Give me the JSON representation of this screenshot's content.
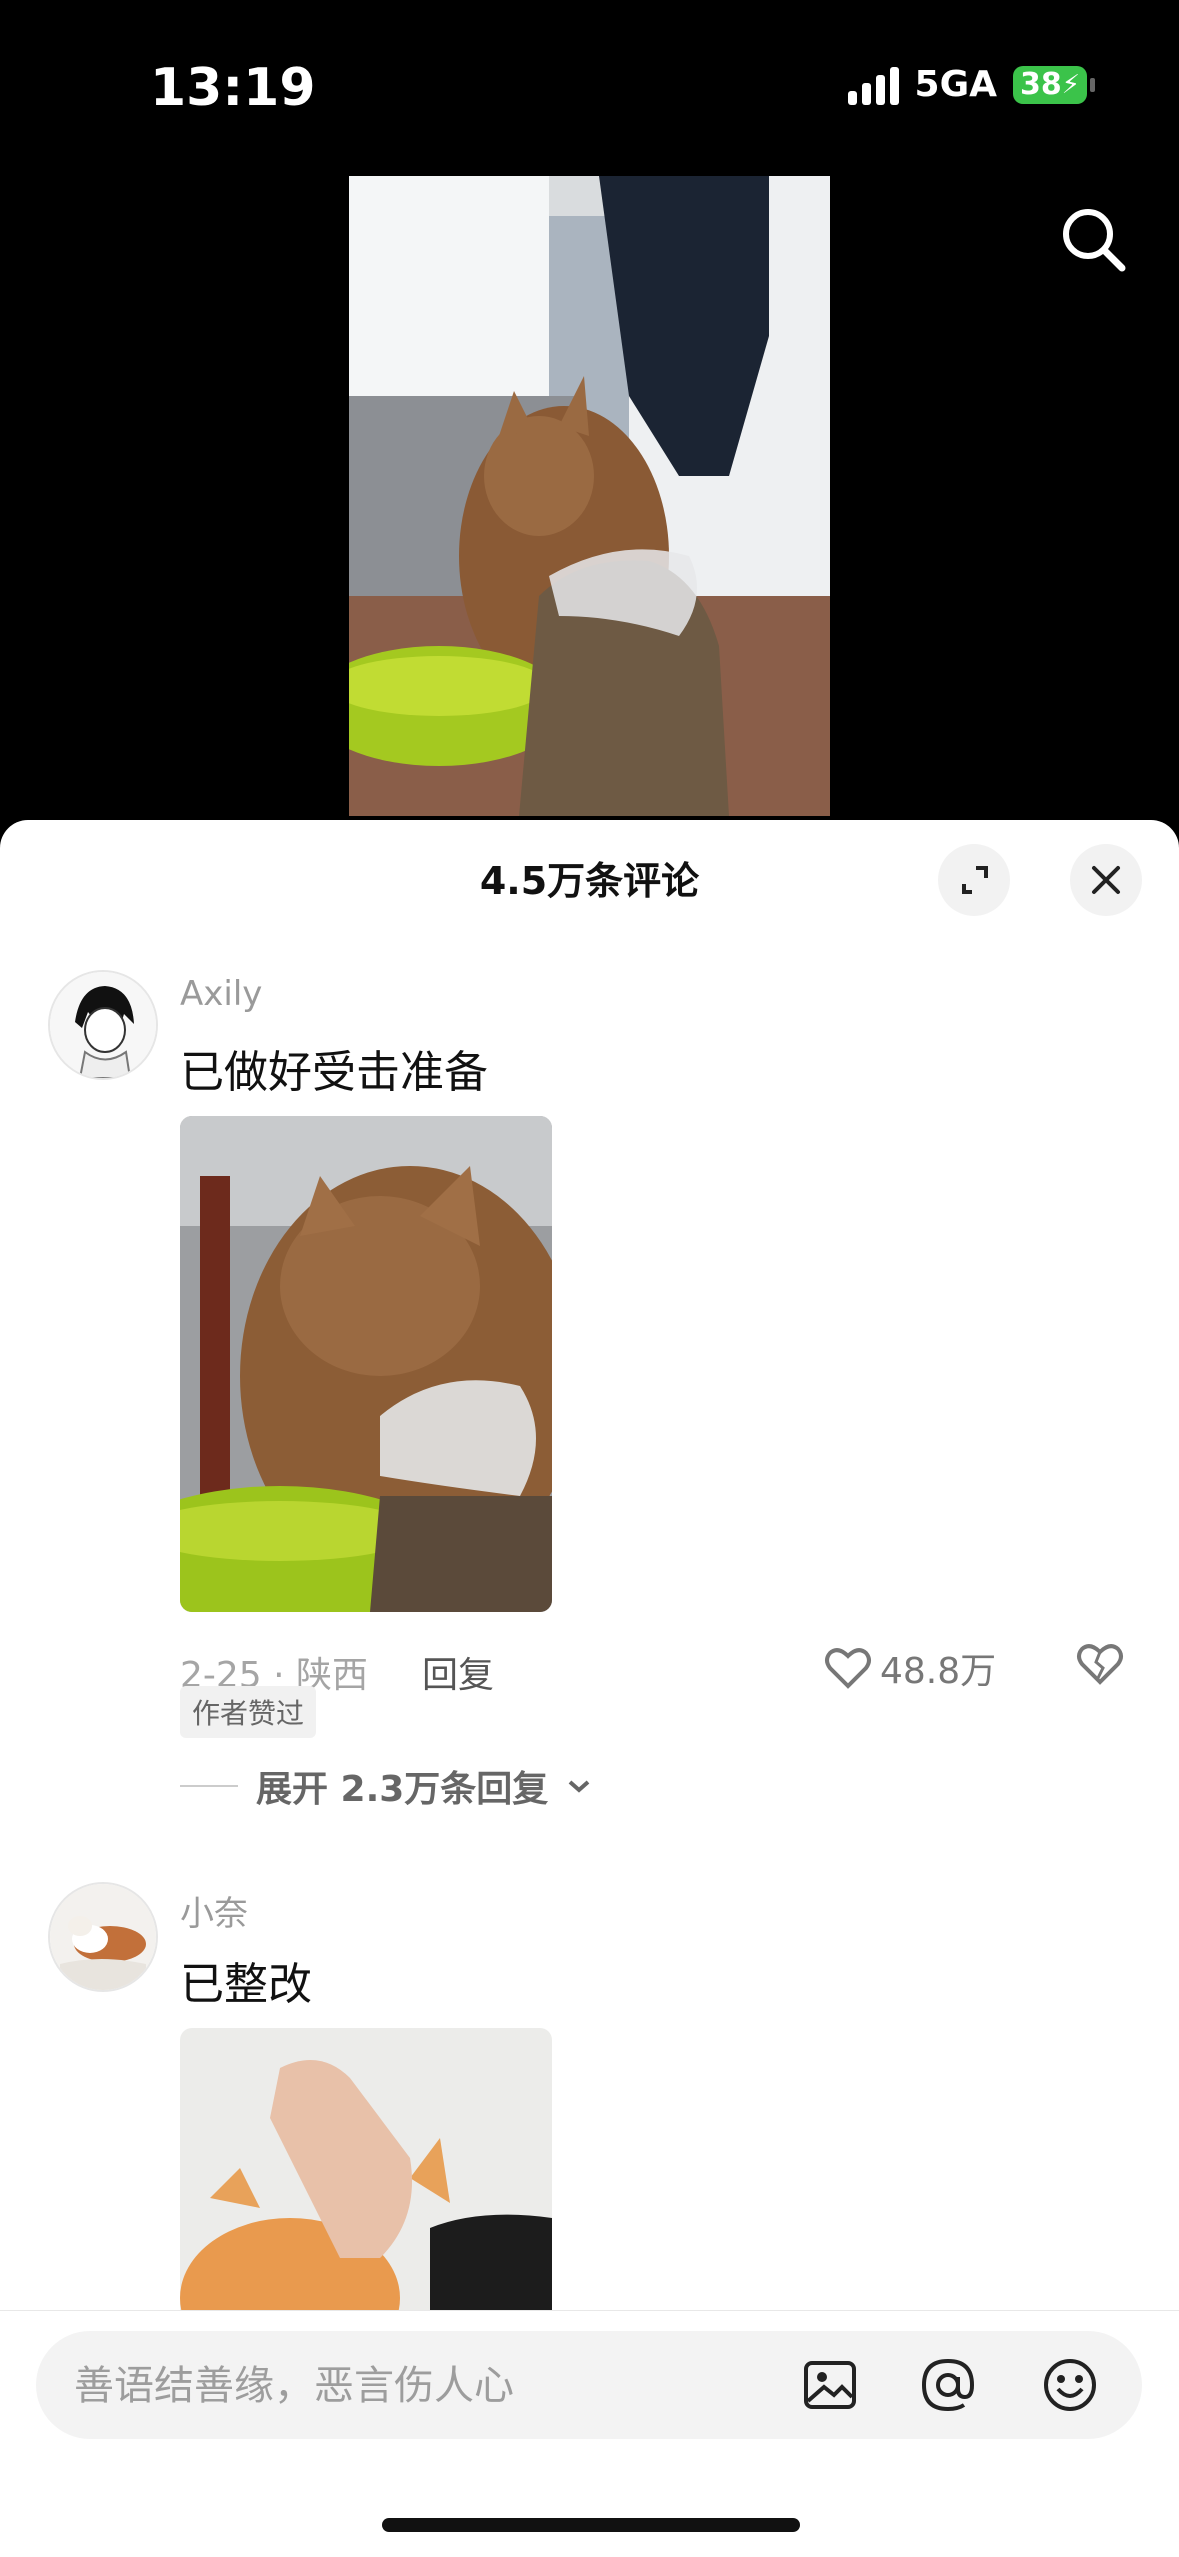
{
  "status": {
    "time": "13:19",
    "network": "5GA",
    "battery": "38"
  },
  "sheet": {
    "title": "4.5万条评论"
  },
  "comments": [
    {
      "username": "Axily",
      "text": "已做好受击准备",
      "date_location": "2-25 · 陕西",
      "reply_label": "回复",
      "likes": "48.8万",
      "badge": "作者赞过",
      "expand_replies": "展开 2.3万条回复"
    },
    {
      "username": "小奈",
      "text": "已整改"
    }
  ],
  "input": {
    "placeholder": "善语结善缘，恶言伤人心"
  },
  "colors": {
    "battery_green": "#3bc34a",
    "sheet_bg": "#ffffff",
    "input_bg": "#f3f3f3"
  }
}
